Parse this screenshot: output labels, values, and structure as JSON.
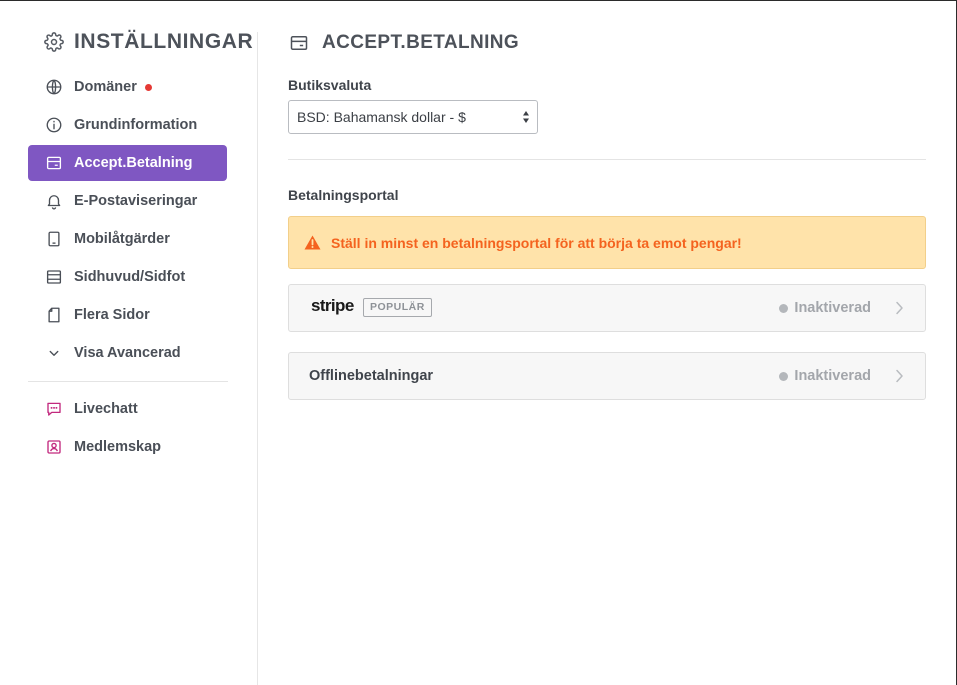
{
  "sidebar": {
    "title": "INSTÄLLNINGAR",
    "items": [
      {
        "label": "Domäner",
        "icon": "globe-icon",
        "notification": true
      },
      {
        "label": "Grundinformation",
        "icon": "info-icon"
      },
      {
        "label": "Accept.Betalning",
        "icon": "card-icon",
        "active": true
      },
      {
        "label": "E-Postaviseringar",
        "icon": "bell-icon"
      },
      {
        "label": "Mobilåtgärder",
        "icon": "mobile-icon"
      },
      {
        "label": "Sidhuvud/Sidfot",
        "icon": "layout-icon"
      },
      {
        "label": "Flera Sidor",
        "icon": "page-icon"
      },
      {
        "label": "Visa Avancerad",
        "icon": "chevron-down-icon"
      }
    ],
    "extra_items": [
      {
        "label": "Livechatt",
        "icon": "chat-icon"
      },
      {
        "label": "Medlemskap",
        "icon": "member-icon"
      }
    ]
  },
  "main": {
    "title": "ACCEPT.BETALNING",
    "currency": {
      "label": "Butiksvaluta",
      "selected": "BSD: Bahamansk dollar - $"
    },
    "portal": {
      "label": "Betalningsportal",
      "alert": "Ställ in minst en betalningsportal för att börja ta emot pengar!",
      "gateways": [
        {
          "name": "stripe",
          "badge": "POPULÄR",
          "status": "Inaktiverad"
        },
        {
          "name": "Offlinebetalningar",
          "status": "Inaktiverad"
        }
      ]
    }
  },
  "colors": {
    "accent": "#7f57c2",
    "alert_bg": "#ffe3aa",
    "alert_text": "#f4631f",
    "notification": "#e53935",
    "extra_icon": "#c2297e"
  }
}
